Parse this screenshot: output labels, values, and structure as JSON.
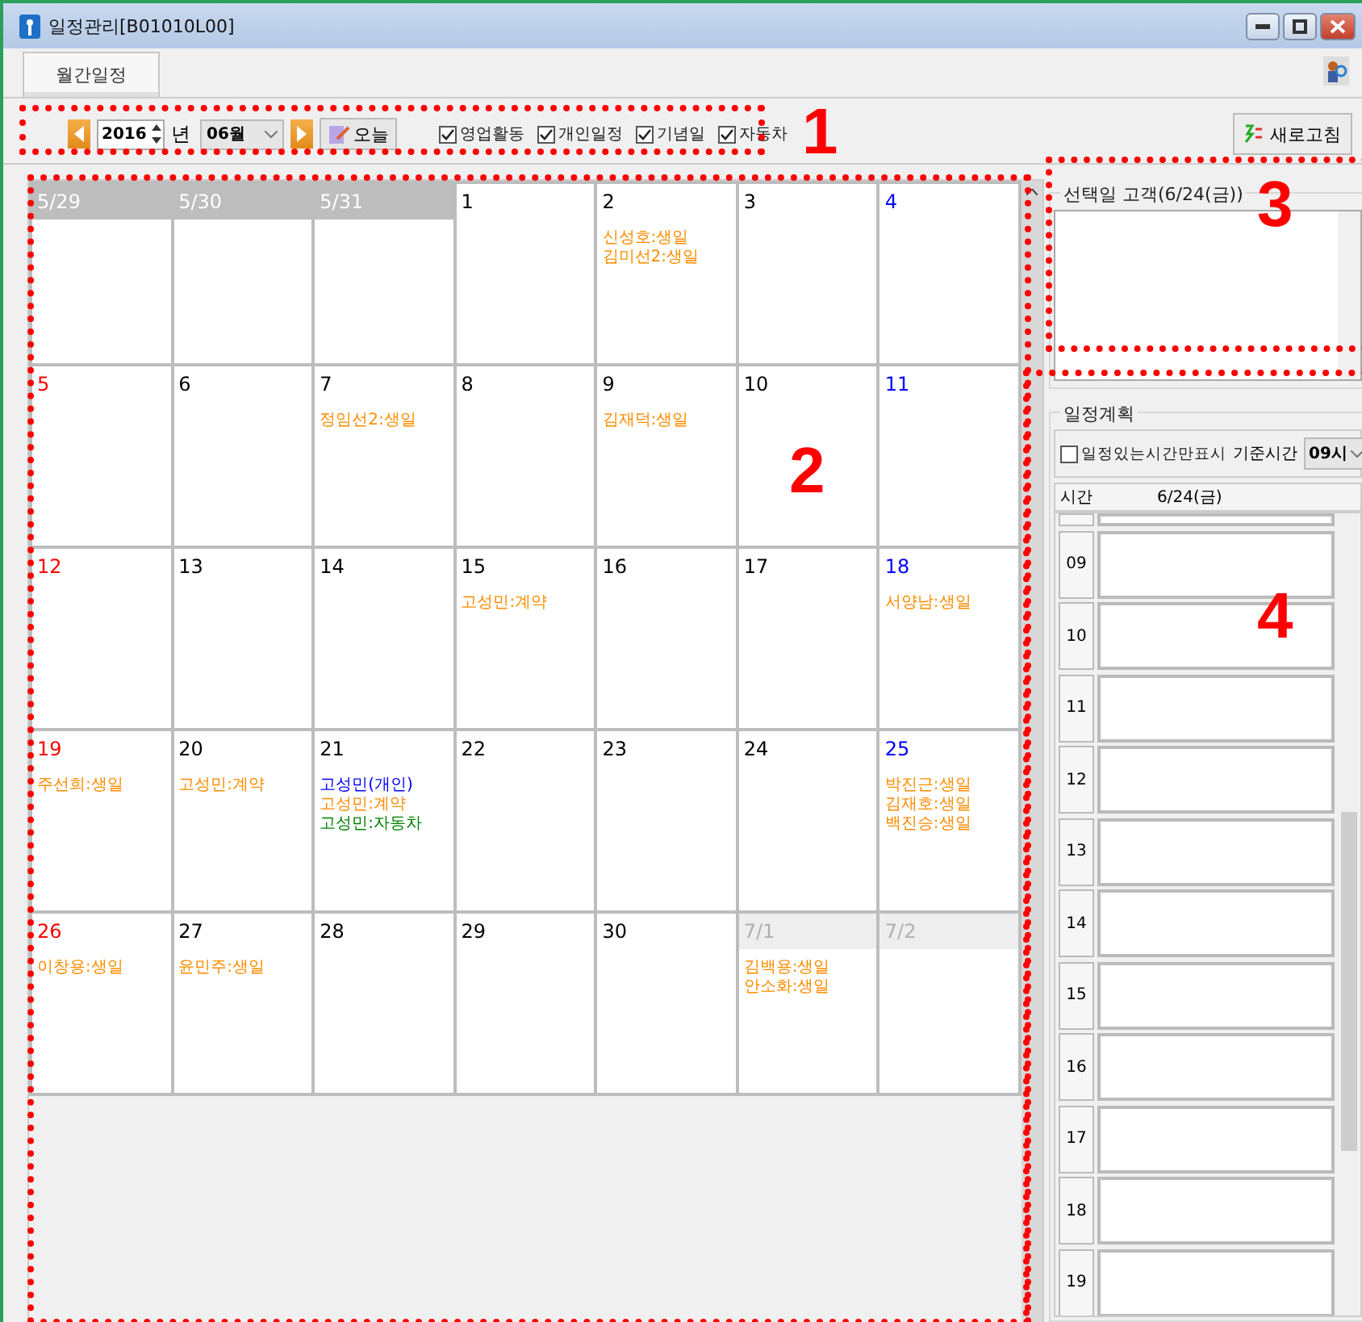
{
  "window": {
    "title": "일정관리[B01010L00]"
  },
  "tabs": [
    {
      "label": "월간일정",
      "selected": true
    }
  ],
  "toolbar": {
    "year": "2016",
    "year_unit": "년",
    "month": "06월",
    "today_button": "오늘",
    "filters": [
      {
        "label": "영업활동",
        "checked": true
      },
      {
        "label": "개인일정",
        "checked": true
      },
      {
        "label": "기념일",
        "checked": true
      },
      {
        "label": "자동차",
        "checked": true
      }
    ],
    "refresh_button": "새로고침"
  },
  "calendar": {
    "weeks": [
      [
        {
          "day": "5/29",
          "kind": "prev"
        },
        {
          "day": "5/30",
          "kind": "prev"
        },
        {
          "day": "5/31",
          "kind": "prev"
        },
        {
          "day": "1",
          "kind": "day"
        },
        {
          "day": "2",
          "kind": "day",
          "events": [
            {
              "text": "신성호:생일",
              "color": "#ff8c00"
            },
            {
              "text": "김미선2:생일",
              "color": "#ff8c00"
            }
          ]
        },
        {
          "day": "3",
          "kind": "day"
        },
        {
          "day": "4",
          "kind": "sat"
        }
      ],
      [
        {
          "day": "5",
          "kind": "sun"
        },
        {
          "day": "6",
          "kind": "day"
        },
        {
          "day": "7",
          "kind": "day",
          "events": [
            {
              "text": "정임선2:생일",
              "color": "#ff8c00"
            }
          ]
        },
        {
          "day": "8",
          "kind": "day"
        },
        {
          "day": "9",
          "kind": "day",
          "events": [
            {
              "text": "김재덕:생일",
              "color": "#ff8c00"
            }
          ]
        },
        {
          "day": "10",
          "kind": "day"
        },
        {
          "day": "11",
          "kind": "sat"
        }
      ],
      [
        {
          "day": "12",
          "kind": "sun"
        },
        {
          "day": "13",
          "kind": "day"
        },
        {
          "day": "14",
          "kind": "day"
        },
        {
          "day": "15",
          "kind": "day",
          "events": [
            {
              "text": "고성민:계약",
              "color": "#ff8c00"
            }
          ]
        },
        {
          "day": "16",
          "kind": "day"
        },
        {
          "day": "17",
          "kind": "day"
        },
        {
          "day": "18",
          "kind": "sat",
          "events": [
            {
              "text": "서양남:생일",
              "color": "#ff8c00"
            }
          ]
        }
      ],
      [
        {
          "day": "19",
          "kind": "sun",
          "events": [
            {
              "text": "주선희:생일",
              "color": "#ff8c00"
            }
          ]
        },
        {
          "day": "20",
          "kind": "day",
          "events": [
            {
              "text": "고성민:계약",
              "color": "#ff8c00"
            }
          ]
        },
        {
          "day": "21",
          "kind": "day",
          "events": [
            {
              "text": "고성민(개인)",
              "color": "#0000ff"
            },
            {
              "text": "고성민:계약",
              "color": "#ff8c00"
            },
            {
              "text": "고성민:자동차",
              "color": "#008000"
            }
          ]
        },
        {
          "day": "22",
          "kind": "day"
        },
        {
          "day": "23",
          "kind": "day"
        },
        {
          "day": "24",
          "kind": "day"
        },
        {
          "day": "25",
          "kind": "sat",
          "events": [
            {
              "text": "박진근:생일",
              "color": "#ff8c00"
            },
            {
              "text": "김재호:생일",
              "color": "#ff8c00"
            },
            {
              "text": "백진승:생일",
              "color": "#ff8c00"
            }
          ]
        }
      ],
      [
        {
          "day": "26",
          "kind": "sun",
          "events": [
            {
              "text": "이창용:생일",
              "color": "#ff8c00"
            }
          ]
        },
        {
          "day": "27",
          "kind": "day",
          "events": [
            {
              "text": "윤민주:생일",
              "color": "#ff8c00"
            }
          ]
        },
        {
          "day": "28",
          "kind": "day"
        },
        {
          "day": "29",
          "kind": "day"
        },
        {
          "day": "30",
          "kind": "day"
        },
        {
          "day": "7/1",
          "kind": "next",
          "events": [
            {
              "text": "김백용:생일",
              "color": "#ff8c00"
            },
            {
              "text": "안소화:생일",
              "color": "#ff8c00"
            }
          ]
        },
        {
          "day": "7/2",
          "kind": "next"
        }
      ]
    ]
  },
  "selected_day_customers": {
    "title": "선택일 고객(6/24(금))"
  },
  "schedule_plan": {
    "title": "일정계획",
    "only_scheduled": {
      "label": "일정있는시간만표시",
      "checked": false
    },
    "base_time_label": "기준시간",
    "base_time": "09시",
    "columns": [
      "시간",
      "6/24(금)"
    ],
    "hours": [
      "09",
      "10",
      "11",
      "12",
      "13",
      "14",
      "15",
      "16",
      "17",
      "18",
      "19"
    ]
  },
  "annotations": [
    {
      "label": "1"
    },
    {
      "label": "2"
    },
    {
      "label": "3"
    },
    {
      "label": "4"
    }
  ]
}
